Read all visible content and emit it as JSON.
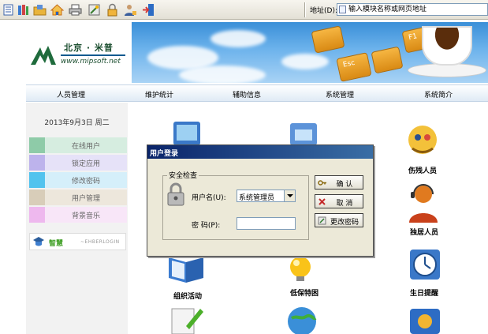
{
  "toolbar": {
    "icons": [
      "list-icon",
      "books-icon",
      "folder-icon",
      "home-icon",
      "printer-icon",
      "tools-icon",
      "lock-icon",
      "user-lock-icon",
      "exit-icon"
    ],
    "address_label": "地址(D):",
    "address_placeholder": "输入模块名称或网页地址"
  },
  "header": {
    "logo_cn": "北京 · 米普",
    "logo_en": "www.mipsoft.net",
    "banner_keys": [
      "Esc",
      "F1"
    ]
  },
  "nav": {
    "items": [
      "人员管理",
      "维护统计",
      "辅助信息",
      "系统管理",
      "系统简介"
    ]
  },
  "sidebar": {
    "date": "2013年9月3日  周二",
    "items": [
      {
        "label": "在线用户",
        "color": "#8ecba8",
        "bg": "#d6ede0"
      },
      {
        "label": "锁定应用",
        "color": "#bdb3ec",
        "bg": "#e6e2f8"
      },
      {
        "label": "修改密码",
        "color": "#52c3ee",
        "bg": "#d5effa"
      },
      {
        "label": "用户管理",
        "color": "#d8cdb9",
        "bg": "#ede7dc"
      },
      {
        "label": "背景音乐",
        "color": "#eeb8ee",
        "bg": "#f8e6f8"
      }
    ],
    "logo_cn": "智慧",
    "logo_en": "~EHBERLOGIN"
  },
  "apps": [
    {
      "label": "伤残人员",
      "icon": "disabled-person-icon"
    },
    {
      "label": "独居人员",
      "icon": "living-alone-icon"
    },
    {
      "label": "组织活动",
      "icon": "book-activity-icon"
    },
    {
      "label": "低保特困",
      "icon": "subsidy-bulb-icon"
    },
    {
      "label": "生日提醒",
      "icon": "birthday-clock-icon"
    }
  ],
  "dialog": {
    "title": "用户登录",
    "group_label": "安全检查",
    "username_label": "用户名(U):",
    "username_value": "系统管理员",
    "password_label": "密  码(P):",
    "confirm_label": "确 认",
    "cancel_label": "取 消",
    "change_pw_label": "更改密码"
  }
}
